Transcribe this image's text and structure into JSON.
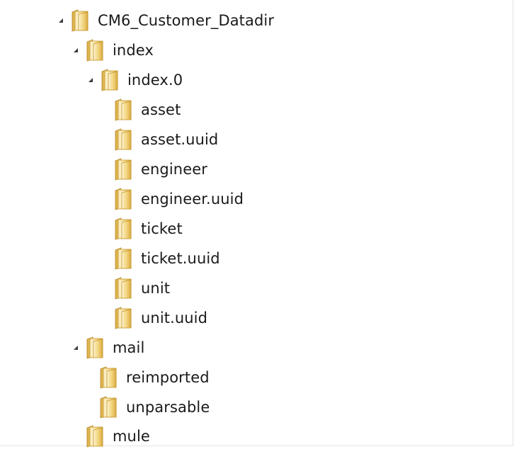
{
  "tree": {
    "root": {
      "label": "CM6_Customer_Datadir",
      "icon": "folder-icon",
      "expanded": true
    },
    "index": {
      "label": "index",
      "icon": "folder-icon",
      "expanded": true
    },
    "index_0": {
      "label": "index.0",
      "icon": "folder-icon",
      "expanded": true
    },
    "asset": {
      "label": "asset",
      "icon": "folder-icon"
    },
    "asset_uuid": {
      "label": "asset.uuid",
      "icon": "folder-icon"
    },
    "engineer": {
      "label": "engineer",
      "icon": "folder-icon"
    },
    "engineer_uuid": {
      "label": "engineer.uuid",
      "icon": "folder-icon"
    },
    "ticket": {
      "label": "ticket",
      "icon": "folder-icon"
    },
    "ticket_uuid": {
      "label": "ticket.uuid",
      "icon": "folder-icon"
    },
    "unit": {
      "label": "unit",
      "icon": "folder-icon"
    },
    "unit_uuid": {
      "label": "unit.uuid",
      "icon": "folder-icon"
    },
    "mail": {
      "label": "mail",
      "icon": "folder-icon",
      "expanded": true
    },
    "reimported": {
      "label": "reimported",
      "icon": "folder-icon"
    },
    "unparsable": {
      "label": "unparsable",
      "icon": "folder-icon"
    },
    "mule": {
      "label": "mule",
      "icon": "folder-icon"
    }
  },
  "colors": {
    "folder_light": "#f8e7a8",
    "folder_mid": "#e9c45a",
    "folder_dark": "#c79a2c",
    "expander": "#3b3b3b"
  }
}
